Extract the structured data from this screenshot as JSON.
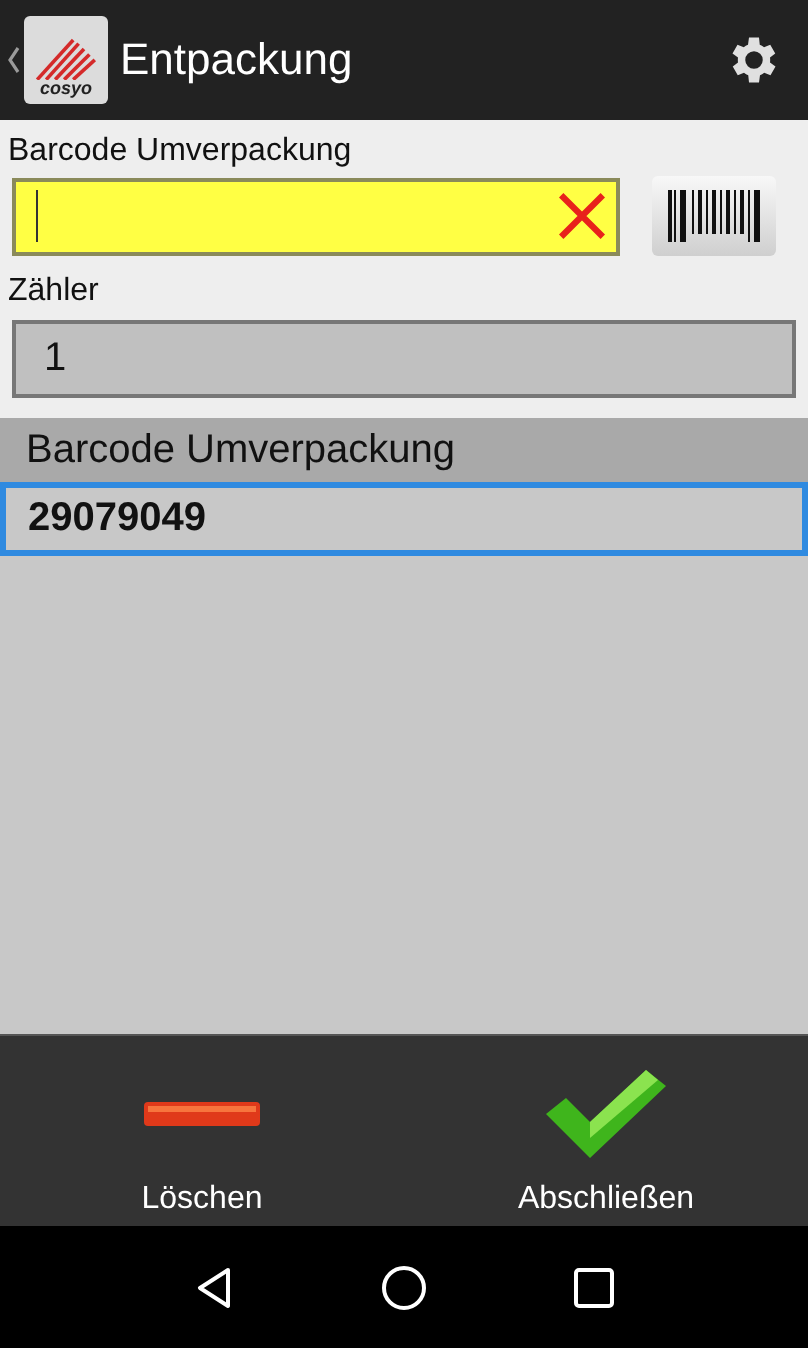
{
  "action_bar": {
    "logo_text": "cosyo",
    "title": "Entpackung"
  },
  "form": {
    "barcode": {
      "label": "Barcode Umverpackung",
      "focused": true
    },
    "counter": {
      "label": "Zähler",
      "value": "1"
    }
  },
  "list": {
    "header": "Barcode Umverpackung",
    "rows": [
      {
        "value": "29079049",
        "selected": true
      }
    ]
  },
  "bottom_actions": [
    {
      "kind": "delete",
      "label": "Löschen"
    },
    {
      "kind": "confirm",
      "label": "Abschließen"
    }
  ]
}
